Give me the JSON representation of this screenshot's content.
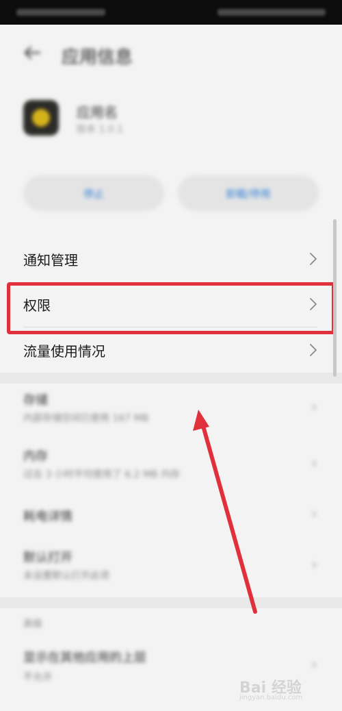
{
  "status_bar": {},
  "header": {
    "title": "应用信息"
  },
  "app": {
    "name": "应用名",
    "version": "版本 1.0.1"
  },
  "actions": {
    "left_label": "停止",
    "right_label": "卸载/停用"
  },
  "menu": [
    {
      "label": "通知管理"
    },
    {
      "label": "权限"
    },
    {
      "label": "流量使用情况"
    }
  ],
  "blurred_items": [
    {
      "title": "存储",
      "subtitle": "内部存储空间已使用 167 MB"
    },
    {
      "title": "内存",
      "subtitle": "过去 3 小时平均使用了 6.2 MB 内存"
    },
    {
      "title": "耗电详情",
      "subtitle": ""
    },
    {
      "title": "默认打开",
      "subtitle": "未设置默认打开此项"
    }
  ],
  "section": {
    "label": "高级",
    "item_title": "显示在其他应用的上层",
    "item_subtitle": "不允许"
  },
  "watermark": {
    "brand": "Bai 经验",
    "url": "jingyan.baidu.com"
  },
  "colors": {
    "highlight": "#e0303c",
    "arrow": "#e0303c",
    "accent_blue": "#2f7fd8"
  },
  "icons": {
    "back": "arrow-left-icon",
    "chevron": "chevron-right-icon"
  }
}
